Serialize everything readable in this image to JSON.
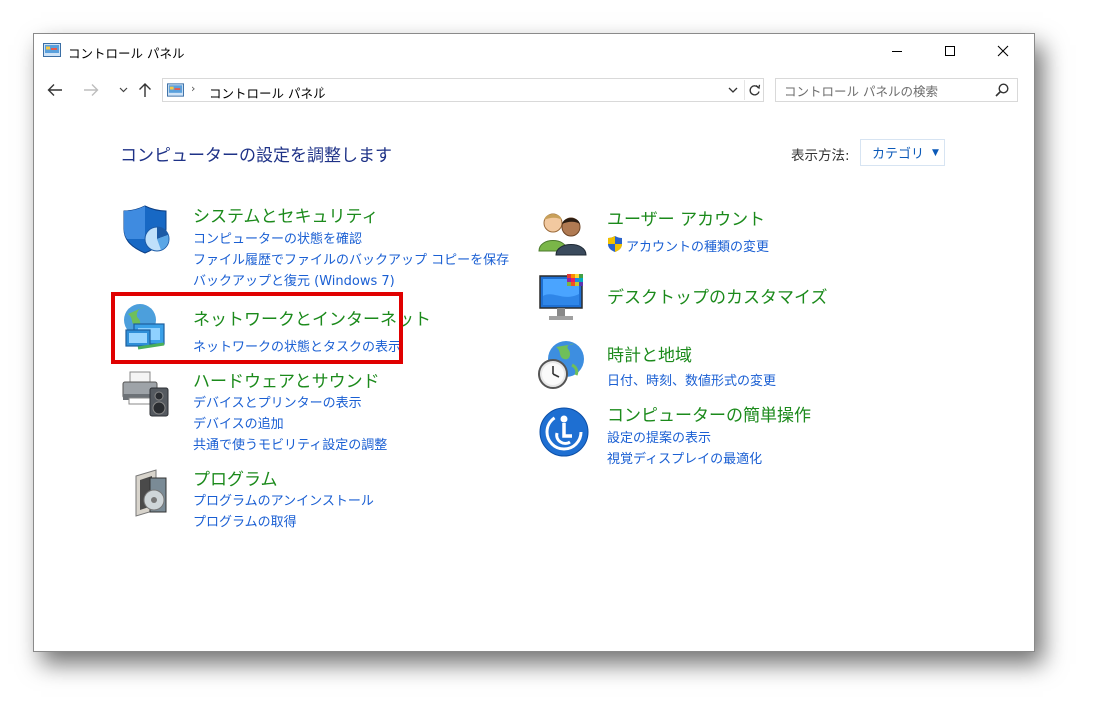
{
  "window": {
    "title": "コントロール パネル"
  },
  "address": {
    "path": "コントロール パネル",
    "separator": "›"
  },
  "search": {
    "placeholder": "コントロール パネルの検索"
  },
  "header": {
    "heading": "コンピューターの設定を調整します",
    "view_by_label": "表示方法:",
    "view_by_value": "カテゴリ"
  },
  "categories": {
    "system": {
      "title": "システムとセキュリティ",
      "links": [
        "コンピューターの状態を確認",
        "ファイル履歴でファイルのバックアップ コピーを保存",
        "バックアップと復元 (Windows 7)"
      ]
    },
    "network": {
      "title": "ネットワークとインターネット",
      "links": [
        "ネットワークの状態とタスクの表示"
      ]
    },
    "hardware": {
      "title": "ハードウェアとサウンド",
      "links": [
        "デバイスとプリンターの表示",
        "デバイスの追加",
        "共通で使うモビリティ設定の調整"
      ]
    },
    "programs": {
      "title": "プログラム",
      "links": [
        "プログラムのアンインストール",
        "プログラムの取得"
      ]
    },
    "user": {
      "title": "ユーザー アカウント",
      "links": [
        "アカウントの種類の変更"
      ]
    },
    "desktop": {
      "title": "デスクトップのカスタマイズ",
      "links": []
    },
    "clock": {
      "title": "時計と地域",
      "links": [
        "日付、時刻、数値形式の変更"
      ]
    },
    "ease": {
      "title": "コンピューターの簡単操作",
      "links": [
        "設定の提案の表示",
        "視覚ディスプレイの最適化"
      ]
    }
  },
  "icons": {
    "title": "control-panel-icon",
    "back": "arrow-left-icon",
    "forward": "arrow-right-icon",
    "history": "chevron-down-icon",
    "up": "arrow-up-icon",
    "refresh": "refresh-icon",
    "search": "search-icon",
    "minimize": "minimize-icon",
    "maximize": "maximize-icon",
    "close": "close-icon"
  },
  "colors": {
    "heading": "#1e3287",
    "category_title": "#1b8a1b",
    "link": "#1a5fd3",
    "highlight": "#e00000"
  }
}
